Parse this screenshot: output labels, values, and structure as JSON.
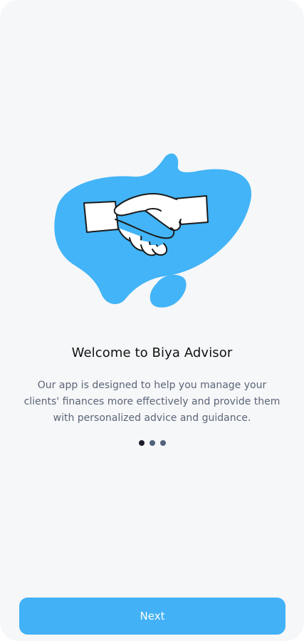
{
  "onboarding": {
    "title": "Welcome to Biya Advisor",
    "description": "Our app is designed to help you manage your clients' finances more effectively and provide them with personalized advice and guidance.",
    "illustration_icon": "handshake-icon",
    "pagination": {
      "total": 3,
      "active_index": 0
    },
    "next_label": "Next"
  },
  "colors": {
    "accent": "#42b1f6",
    "background": "#f6f7f8",
    "dot_active": "#1d1d2b",
    "dot_inactive": "#51627e"
  }
}
